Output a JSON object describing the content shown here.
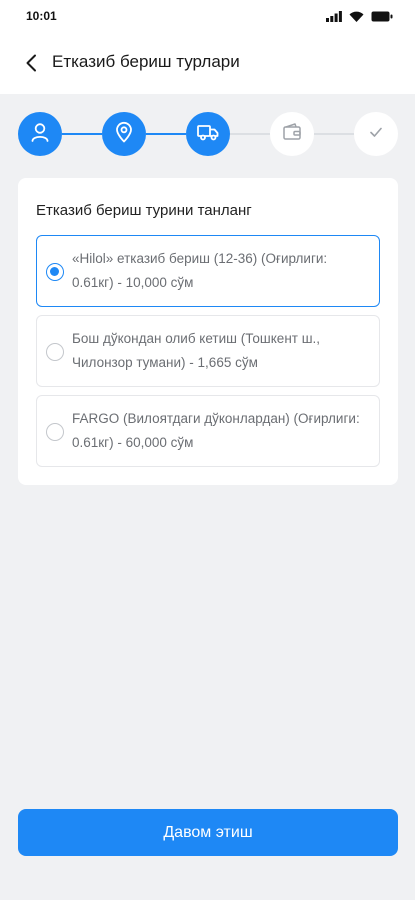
{
  "status_bar": {
    "time": "10:01",
    "icons": [
      "signal-icon",
      "wifi-icon",
      "battery-icon"
    ]
  },
  "header": {
    "back_icon": "chevron-left-icon",
    "title": "Етказиб бериш турлари"
  },
  "stepper": {
    "steps": [
      {
        "icon": "user-icon",
        "state": "completed"
      },
      {
        "icon": "location-pin-icon",
        "state": "completed"
      },
      {
        "icon": "truck-icon",
        "state": "current"
      },
      {
        "icon": "wallet-icon",
        "state": "upcoming"
      },
      {
        "icon": "check-icon",
        "state": "upcoming"
      }
    ]
  },
  "delivery": {
    "title": "Етказиб бериш турини танланг",
    "options": [
      {
        "label": "«Hilol» етказиб бериш (12-36) (Оғирлиги: 0.61кг) - 10,000 сўм",
        "selected": true
      },
      {
        "label": "Бош дўкондан олиб кетиш (Тошкент ш., Чилонзор тумани) - 1,665 сўм",
        "selected": false
      },
      {
        "label": "FARGO (Вилоятдаги дўконлардан) (Оғирлиги: 0.61кг) - 60,000 сўм",
        "selected": false
      }
    ]
  },
  "continue_button": {
    "label": "Давом этиш"
  },
  "colors": {
    "accent": "#1e88f5",
    "background": "#f0f1f3",
    "card": "#ffffff",
    "inactive_line": "#dcdfe3"
  }
}
